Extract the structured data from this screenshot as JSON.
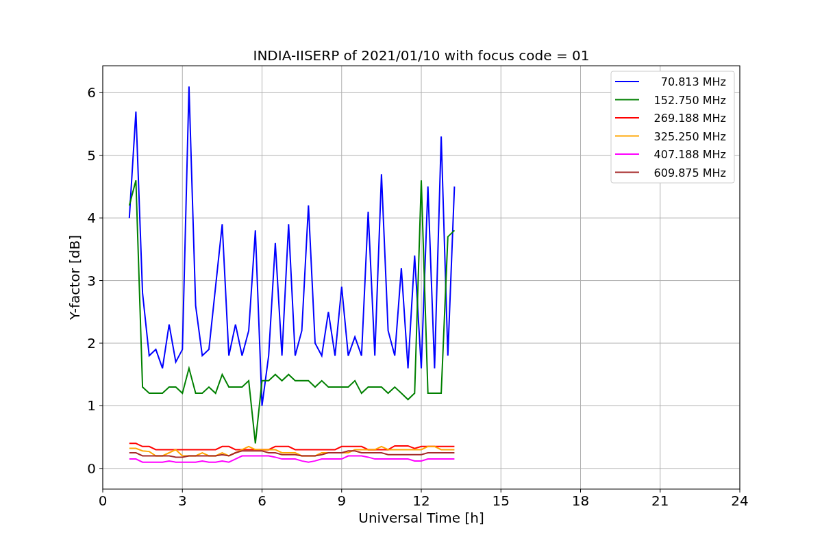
{
  "chart_data": {
    "type": "line",
    "title": "INDIA-IISERP of 2021/01/10 with focus code = 01",
    "xlabel": "Universal Time [h]",
    "ylabel": "Y-factor [dB]",
    "x": [
      1.0,
      1.25,
      1.5,
      1.75,
      2.0,
      2.25,
      2.5,
      2.75,
      3.0,
      3.25,
      3.5,
      3.75,
      4.0,
      4.25,
      4.5,
      4.75,
      5.0,
      5.25,
      5.5,
      5.75,
      6.0,
      6.25,
      6.5,
      6.75,
      7.0,
      7.25,
      7.5,
      7.75,
      8.0,
      8.25,
      8.5,
      8.75,
      9.0,
      9.25,
      9.5,
      9.75,
      10.0,
      10.25,
      10.5,
      10.75,
      11.0,
      11.25,
      11.5,
      11.75,
      12.0,
      12.25,
      12.5,
      12.75,
      13.0,
      13.25
    ],
    "series": [
      {
        "name": " 70.813 MHz",
        "color": "#0000ff",
        "values": [
          4.0,
          5.7,
          2.8,
          1.8,
          1.9,
          1.6,
          2.3,
          1.7,
          1.9,
          6.1,
          2.6,
          1.8,
          1.9,
          2.9,
          3.9,
          1.8,
          2.3,
          1.8,
          2.2,
          3.8,
          1.0,
          1.8,
          3.6,
          1.8,
          3.9,
          1.8,
          2.2,
          4.2,
          2.0,
          1.8,
          2.5,
          1.8,
          2.9,
          1.8,
          2.1,
          1.8,
          4.1,
          1.8,
          4.7,
          2.2,
          1.8,
          3.2,
          1.6,
          3.4,
          1.6,
          4.5,
          1.6,
          5.3,
          1.8,
          4.5
        ]
      },
      {
        "name": "152.750 MHz",
        "color": "#008000",
        "values": [
          4.2,
          4.6,
          1.3,
          1.2,
          1.2,
          1.2,
          1.3,
          1.3,
          1.2,
          1.6,
          1.2,
          1.2,
          1.3,
          1.2,
          1.5,
          1.3,
          1.3,
          1.3,
          1.4,
          0.4,
          1.4,
          1.4,
          1.5,
          1.4,
          1.5,
          1.4,
          1.4,
          1.4,
          1.3,
          1.4,
          1.3,
          1.3,
          1.3,
          1.3,
          1.4,
          1.2,
          1.3,
          1.3,
          1.3,
          1.2,
          1.3,
          1.2,
          1.1,
          1.2,
          4.6,
          1.2,
          1.2,
          1.2,
          3.7,
          3.8
        ]
      },
      {
        "name": "269.188 MHz",
        "color": "#ff0000",
        "values": [
          0.4,
          0.4,
          0.35,
          0.35,
          0.3,
          0.3,
          0.3,
          0.3,
          0.3,
          0.3,
          0.3,
          0.3,
          0.3,
          0.3,
          0.35,
          0.35,
          0.3,
          0.3,
          0.3,
          0.3,
          0.3,
          0.3,
          0.35,
          0.35,
          0.35,
          0.3,
          0.3,
          0.3,
          0.3,
          0.3,
          0.3,
          0.3,
          0.35,
          0.35,
          0.35,
          0.35,
          0.3,
          0.3,
          0.3,
          0.3,
          0.36,
          0.36,
          0.36,
          0.32,
          0.35,
          0.35,
          0.35,
          0.35,
          0.35,
          0.35
        ]
      },
      {
        "name": "325.250 MHz",
        "color": "#ffa500",
        "values": [
          0.32,
          0.32,
          0.28,
          0.27,
          0.2,
          0.2,
          0.25,
          0.3,
          0.2,
          0.2,
          0.2,
          0.25,
          0.2,
          0.2,
          0.25,
          0.2,
          0.25,
          0.3,
          0.35,
          0.3,
          0.3,
          0.3,
          0.3,
          0.25,
          0.25,
          0.25,
          0.2,
          0.2,
          0.2,
          0.25,
          0.25,
          0.25,
          0.25,
          0.25,
          0.3,
          0.3,
          0.3,
          0.3,
          0.35,
          0.3,
          0.3,
          0.3,
          0.3,
          0.3,
          0.3,
          0.35,
          0.35,
          0.3,
          0.3,
          0.3
        ]
      },
      {
        "name": "407.188 MHz",
        "color": "#ff00ff",
        "values": [
          0.15,
          0.15,
          0.1,
          0.1,
          0.1,
          0.1,
          0.12,
          0.1,
          0.1,
          0.1,
          0.1,
          0.12,
          0.1,
          0.1,
          0.12,
          0.1,
          0.15,
          0.2,
          0.2,
          0.2,
          0.2,
          0.2,
          0.18,
          0.15,
          0.15,
          0.15,
          0.12,
          0.1,
          0.12,
          0.15,
          0.15,
          0.15,
          0.15,
          0.2,
          0.2,
          0.2,
          0.18,
          0.15,
          0.15,
          0.15,
          0.15,
          0.15,
          0.15,
          0.12,
          0.12,
          0.15,
          0.15,
          0.15,
          0.15,
          0.15
        ]
      },
      {
        "name": "609.875 MHz",
        "color": "#a52a2a",
        "values": [
          0.25,
          0.25,
          0.2,
          0.2,
          0.2,
          0.2,
          0.2,
          0.18,
          0.18,
          0.2,
          0.2,
          0.2,
          0.2,
          0.2,
          0.22,
          0.2,
          0.25,
          0.28,
          0.28,
          0.28,
          0.28,
          0.25,
          0.25,
          0.22,
          0.22,
          0.22,
          0.2,
          0.2,
          0.2,
          0.22,
          0.25,
          0.25,
          0.25,
          0.28,
          0.28,
          0.25,
          0.25,
          0.25,
          0.25,
          0.22,
          0.22,
          0.22,
          0.22,
          0.22,
          0.22,
          0.25,
          0.25,
          0.25,
          0.25,
          0.25
        ]
      }
    ],
    "xlim": [
      0,
      24
    ],
    "ylim": [
      -0.33,
      6.43
    ],
    "xticks": [
      0,
      3,
      6,
      9,
      12,
      15,
      18,
      21,
      24
    ],
    "yticks": [
      0,
      1,
      2,
      3,
      4,
      5,
      6
    ],
    "grid": true,
    "legend": "upper right"
  }
}
